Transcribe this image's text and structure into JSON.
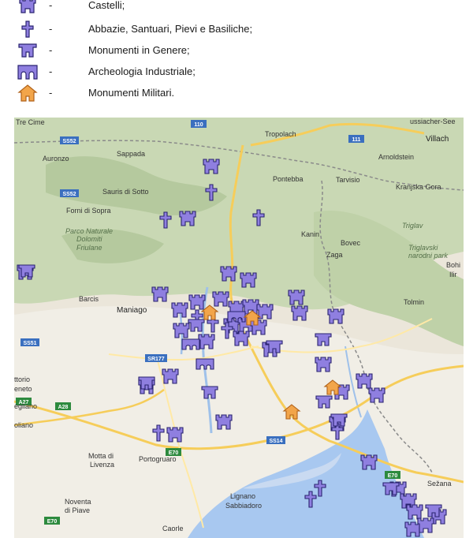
{
  "legend": {
    "dash": "-",
    "items": [
      {
        "icon": "castle-icon",
        "label": "Castelli;"
      },
      {
        "icon": "cross-icon",
        "label": "Abbazie, Santuari, Pievi e Basiliche;"
      },
      {
        "icon": "monument-icon",
        "label": "Monumenti in Genere;"
      },
      {
        "icon": "arch-icon",
        "label": "Archeologia Industriale;"
      },
      {
        "icon": "military-icon",
        "label": "Monumenti Militari."
      }
    ]
  },
  "colors": {
    "marker_purple": "#8f7fe0",
    "marker_outline": "#2a2470",
    "military_orange": "#f2a54a",
    "sea": "#a8c8f0",
    "land": "#ebe6da",
    "mountain": "#c9d8b4",
    "road_yellow": "#f6cd5a",
    "border": "#8a8a8a"
  },
  "map": {
    "places": {
      "tre_cime": "Tre Cime",
      "auronzo": "Auronzo",
      "sappada": "Sappada",
      "sauris": "Sauris di Sotto",
      "forni": "Forni di Sopra",
      "parco": [
        "Parco Naturale",
        "Dolomiti",
        "Friulane"
      ],
      "tropolach": "Tropolach",
      "villach": "Villach",
      "arnoldstein": "Arnoldstein",
      "pontebba": "Pontebba",
      "tarvisio": "Tarvisio",
      "kranjska": "Kranjska Gora",
      "triglav": "Triglav",
      "triglavski": [
        "Triglavski",
        "narodni park"
      ],
      "kanin": "Kanin",
      "bovec": "Bovec",
      "zaga": "Zaga",
      "bohinj": [
        "Bohi",
        "Ilir"
      ],
      "barcis": "Barcis",
      "maniago": "Maniago",
      "tolmin": "Tolmin",
      "ettorio": "ttorio",
      "veneto": "eneto",
      "egliano": "egliano",
      "oliano": "oliano",
      "motta": [
        "Motta di",
        "Livenza"
      ],
      "portogruaro": "Portogruaro",
      "noventa": [
        "Noventa",
        "di Piave"
      ],
      "lignano": [
        "Lignano",
        "Sabbiadoro"
      ],
      "caorle": "Caorle",
      "sezana": "Sežana",
      "ussiacher": "ussiacher-See"
    },
    "roads": {
      "r110": "110",
      "r111": "111",
      "ss52a": "SS52",
      "ss52b": "SS52",
      "ss51": "SS51",
      "sr177": "SR177",
      "ss14": "SS14",
      "a27": "A27",
      "a28": "A28",
      "e70a": "E70",
      "e70b": "E70",
      "e70c": "E70"
    },
    "markers": {
      "castles": 38,
      "crosses": 10,
      "monuments": 22,
      "arches": 3,
      "military": 4
    }
  }
}
